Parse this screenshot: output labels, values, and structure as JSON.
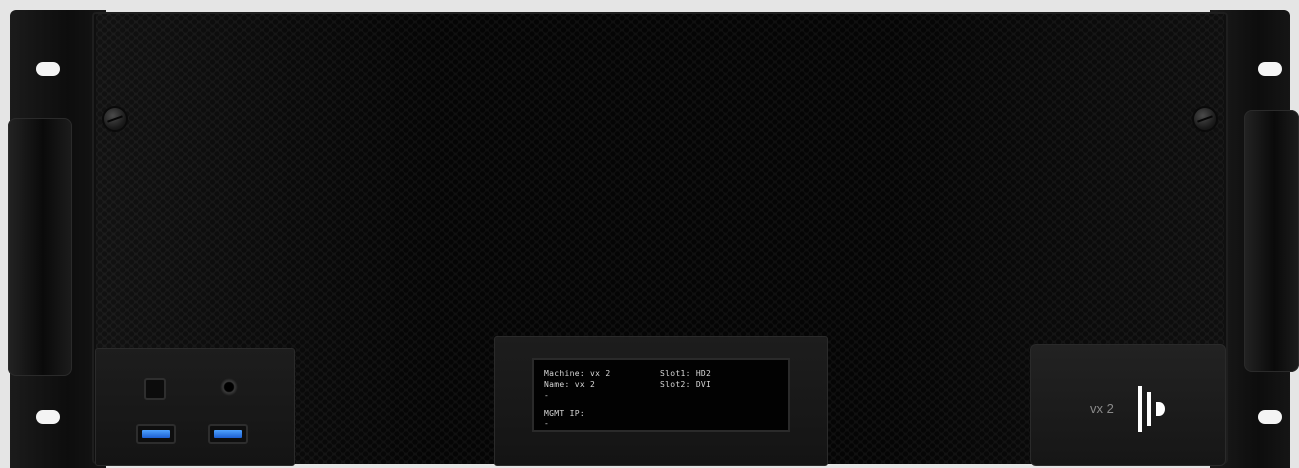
{
  "device": {
    "model_label": "vx 2",
    "logo_icon": "vx-logo-icon"
  },
  "front_io": {
    "power_icon": "power-button-icon",
    "audio_icon": "audio-jack-icon",
    "usb_icon": "usb-port-icon",
    "usb_accent": "#2f7ef0"
  },
  "lcd": {
    "left_lines": [
      "Machine: vx 2",
      "Name: vx 2",
      "-",
      "",
      "MGMT IP:",
      "-"
    ],
    "right_lines": [
      "Slot1: HD2",
      "Slot2: DVI"
    ]
  },
  "colors": {
    "chassis": "#0f0f0f",
    "background": "#e5e5e5",
    "logo": "#ffffff"
  }
}
